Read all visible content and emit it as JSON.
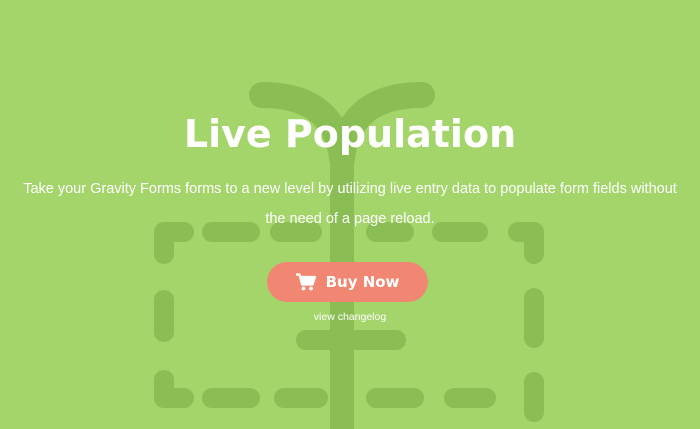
{
  "hero": {
    "title": "Live Population",
    "description_line1": "Take your Gravity Forms forms to a new level by utilizing live entry data to populate form fields without",
    "description_line2": "the need of a page reload.",
    "buy_label": "Buy Now",
    "changelog_label": "view changelog"
  },
  "icons": {
    "cart": "shopping-cart-icon",
    "illustration": "tree-and-dashed-frame-illustration"
  },
  "colors": {
    "background": "#a3d56a",
    "illustration": "#8bbd55",
    "button": "#f18672",
    "changelog_text": "#ffffff"
  }
}
